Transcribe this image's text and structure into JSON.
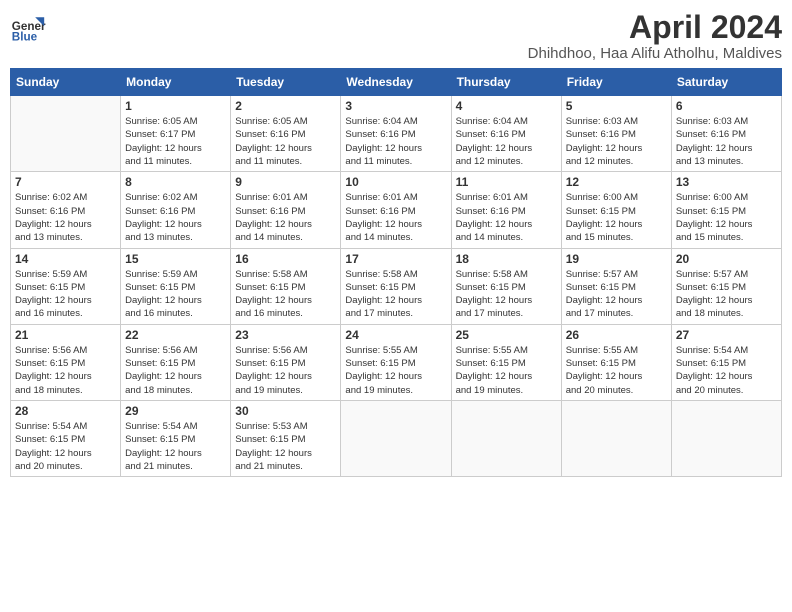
{
  "header": {
    "logo_line1": "General",
    "logo_line2": "Blue",
    "month_year": "April 2024",
    "location": "Dhihdhoo, Haa Alifu Atholhu, Maldives"
  },
  "weekdays": [
    "Sunday",
    "Monday",
    "Tuesday",
    "Wednesday",
    "Thursday",
    "Friday",
    "Saturday"
  ],
  "weeks": [
    [
      {
        "day": "",
        "info": ""
      },
      {
        "day": "1",
        "info": "Sunrise: 6:05 AM\nSunset: 6:17 PM\nDaylight: 12 hours\nand 11 minutes."
      },
      {
        "day": "2",
        "info": "Sunrise: 6:05 AM\nSunset: 6:16 PM\nDaylight: 12 hours\nand 11 minutes."
      },
      {
        "day": "3",
        "info": "Sunrise: 6:04 AM\nSunset: 6:16 PM\nDaylight: 12 hours\nand 11 minutes."
      },
      {
        "day": "4",
        "info": "Sunrise: 6:04 AM\nSunset: 6:16 PM\nDaylight: 12 hours\nand 12 minutes."
      },
      {
        "day": "5",
        "info": "Sunrise: 6:03 AM\nSunset: 6:16 PM\nDaylight: 12 hours\nand 12 minutes."
      },
      {
        "day": "6",
        "info": "Sunrise: 6:03 AM\nSunset: 6:16 PM\nDaylight: 12 hours\nand 13 minutes."
      }
    ],
    [
      {
        "day": "7",
        "info": "Sunrise: 6:02 AM\nSunset: 6:16 PM\nDaylight: 12 hours\nand 13 minutes."
      },
      {
        "day": "8",
        "info": "Sunrise: 6:02 AM\nSunset: 6:16 PM\nDaylight: 12 hours\nand 13 minutes."
      },
      {
        "day": "9",
        "info": "Sunrise: 6:01 AM\nSunset: 6:16 PM\nDaylight: 12 hours\nand 14 minutes."
      },
      {
        "day": "10",
        "info": "Sunrise: 6:01 AM\nSunset: 6:16 PM\nDaylight: 12 hours\nand 14 minutes."
      },
      {
        "day": "11",
        "info": "Sunrise: 6:01 AM\nSunset: 6:16 PM\nDaylight: 12 hours\nand 14 minutes."
      },
      {
        "day": "12",
        "info": "Sunrise: 6:00 AM\nSunset: 6:15 PM\nDaylight: 12 hours\nand 15 minutes."
      },
      {
        "day": "13",
        "info": "Sunrise: 6:00 AM\nSunset: 6:15 PM\nDaylight: 12 hours\nand 15 minutes."
      }
    ],
    [
      {
        "day": "14",
        "info": "Sunrise: 5:59 AM\nSunset: 6:15 PM\nDaylight: 12 hours\nand 16 minutes."
      },
      {
        "day": "15",
        "info": "Sunrise: 5:59 AM\nSunset: 6:15 PM\nDaylight: 12 hours\nand 16 minutes."
      },
      {
        "day": "16",
        "info": "Sunrise: 5:58 AM\nSunset: 6:15 PM\nDaylight: 12 hours\nand 16 minutes."
      },
      {
        "day": "17",
        "info": "Sunrise: 5:58 AM\nSunset: 6:15 PM\nDaylight: 12 hours\nand 17 minutes."
      },
      {
        "day": "18",
        "info": "Sunrise: 5:58 AM\nSunset: 6:15 PM\nDaylight: 12 hours\nand 17 minutes."
      },
      {
        "day": "19",
        "info": "Sunrise: 5:57 AM\nSunset: 6:15 PM\nDaylight: 12 hours\nand 17 minutes."
      },
      {
        "day": "20",
        "info": "Sunrise: 5:57 AM\nSunset: 6:15 PM\nDaylight: 12 hours\nand 18 minutes."
      }
    ],
    [
      {
        "day": "21",
        "info": "Sunrise: 5:56 AM\nSunset: 6:15 PM\nDaylight: 12 hours\nand 18 minutes."
      },
      {
        "day": "22",
        "info": "Sunrise: 5:56 AM\nSunset: 6:15 PM\nDaylight: 12 hours\nand 18 minutes."
      },
      {
        "day": "23",
        "info": "Sunrise: 5:56 AM\nSunset: 6:15 PM\nDaylight: 12 hours\nand 19 minutes."
      },
      {
        "day": "24",
        "info": "Sunrise: 5:55 AM\nSunset: 6:15 PM\nDaylight: 12 hours\nand 19 minutes."
      },
      {
        "day": "25",
        "info": "Sunrise: 5:55 AM\nSunset: 6:15 PM\nDaylight: 12 hours\nand 19 minutes."
      },
      {
        "day": "26",
        "info": "Sunrise: 5:55 AM\nSunset: 6:15 PM\nDaylight: 12 hours\nand 20 minutes."
      },
      {
        "day": "27",
        "info": "Sunrise: 5:54 AM\nSunset: 6:15 PM\nDaylight: 12 hours\nand 20 minutes."
      }
    ],
    [
      {
        "day": "28",
        "info": "Sunrise: 5:54 AM\nSunset: 6:15 PM\nDaylight: 12 hours\nand 20 minutes."
      },
      {
        "day": "29",
        "info": "Sunrise: 5:54 AM\nSunset: 6:15 PM\nDaylight: 12 hours\nand 21 minutes."
      },
      {
        "day": "30",
        "info": "Sunrise: 5:53 AM\nSunset: 6:15 PM\nDaylight: 12 hours\nand 21 minutes."
      },
      {
        "day": "",
        "info": ""
      },
      {
        "day": "",
        "info": ""
      },
      {
        "day": "",
        "info": ""
      },
      {
        "day": "",
        "info": ""
      }
    ]
  ]
}
